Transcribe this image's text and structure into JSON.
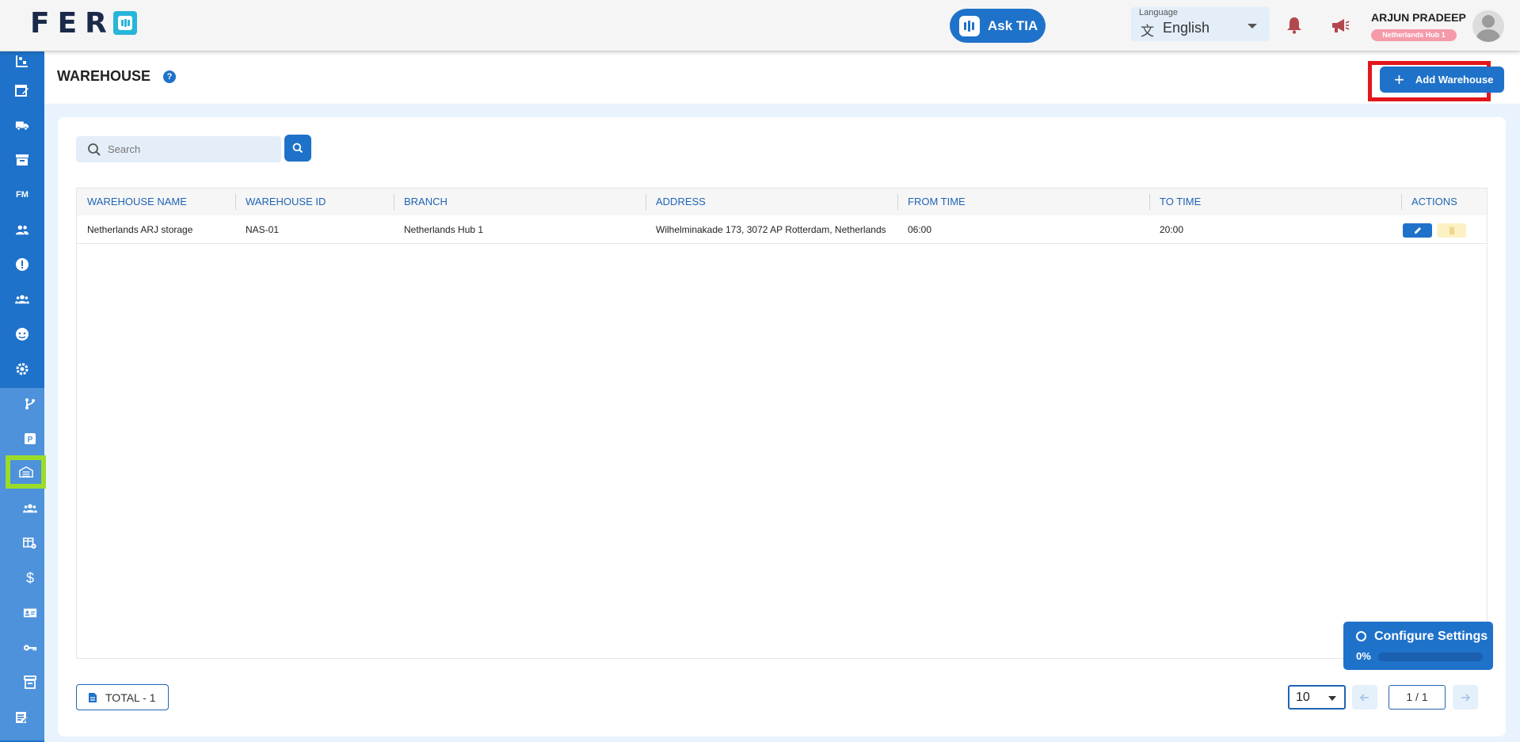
{
  "app": {
    "logo_text": "FER"
  },
  "header": {
    "ask_label": "Ask TIA",
    "language_label": "Language",
    "language_value": "English",
    "user_name": "ARJUN PRADEEP",
    "user_branch": "Netherlands Hub 1"
  },
  "sidebar": {
    "items": [
      {
        "icon": "dashboard-icon"
      },
      {
        "icon": "calendar-edit-icon"
      },
      {
        "icon": "truck-icon"
      },
      {
        "icon": "archive-icon"
      },
      {
        "icon": "fm-icon",
        "label": "FM"
      },
      {
        "icon": "users-icon"
      },
      {
        "icon": "info-icon"
      },
      {
        "icon": "group-icon"
      },
      {
        "icon": "face-icon"
      },
      {
        "icon": "settings-icon"
      },
      {
        "icon": "branch-icon"
      },
      {
        "icon": "parking-icon",
        "label": "P"
      },
      {
        "icon": "warehouse-icon",
        "active": true
      },
      {
        "icon": "team-icon"
      },
      {
        "icon": "table-settings-icon"
      },
      {
        "icon": "dollar-icon",
        "label": "$"
      },
      {
        "icon": "id-card-icon"
      },
      {
        "icon": "key-icon"
      },
      {
        "icon": "store-icon"
      },
      {
        "icon": "note-edit-icon"
      }
    ]
  },
  "page": {
    "title": "WAREHOUSE",
    "help": "?",
    "add_button": "Add Warehouse"
  },
  "search": {
    "placeholder": "Search"
  },
  "table": {
    "columns": [
      "WAREHOUSE NAME",
      "WAREHOUSE ID",
      "BRANCH",
      "ADDRESS",
      "FROM TIME",
      "TO TIME",
      "ACTIONS"
    ],
    "rows": [
      {
        "name": "Netherlands ARJ storage",
        "id": "NAS-01",
        "branch": "Netherlands Hub 1",
        "address": "Wilhelminakade 173, 3072 AP Rotterdam, Netherlands",
        "from": "06:00",
        "to": "20:00"
      }
    ]
  },
  "footer": {
    "total": "TOTAL  - 1",
    "page_size": "10",
    "page_indicator": "1 / 1"
  },
  "configure": {
    "title": "Configure Settings",
    "progress": "0%",
    "progress_value": 0
  },
  "colors": {
    "primary": "#1f72c9",
    "sidebar_sub": "#4d92db",
    "active_highlight": "#9bdc2a",
    "annotation_red": "#e3161c",
    "badge_pink": "#f59aa9"
  }
}
